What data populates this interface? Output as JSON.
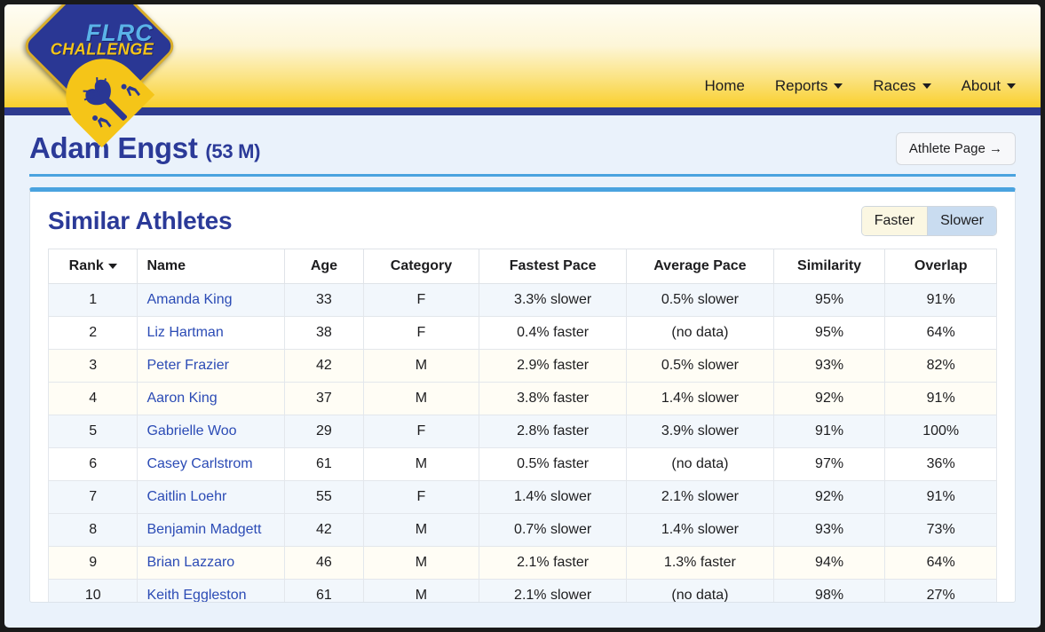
{
  "header": {
    "logo": {
      "line1": "FLRC",
      "line2": "CHALLENGE",
      "alt": "flrc-challenge-logo"
    },
    "nav": [
      {
        "label": "Home",
        "has_caret": false
      },
      {
        "label": "Reports",
        "has_caret": true
      },
      {
        "label": "Races",
        "has_caret": true
      },
      {
        "label": "About",
        "has_caret": true
      }
    ]
  },
  "page": {
    "athlete_name": "Adam Engst",
    "athlete_meta": "(53 M)",
    "athlete_page_button": "Athlete Page →"
  },
  "card": {
    "title": "Similar Athletes",
    "toggle": {
      "faster": "Faster",
      "slower": "Slower",
      "selected": "Slower"
    },
    "columns": [
      "Rank",
      "Name",
      "Age",
      "Category",
      "Fastest Pace",
      "Average Pace",
      "Similarity",
      "Overlap"
    ],
    "sorted_by": "Rank",
    "rows": [
      {
        "rank": "1",
        "name": "Amanda King",
        "age": "33",
        "category": "F",
        "fastest": "3.3% slower",
        "average": "0.5% slower",
        "similarity": "95%",
        "overlap": "91%",
        "tint": "blue"
      },
      {
        "rank": "2",
        "name": "Liz Hartman",
        "age": "38",
        "category": "F",
        "fastest": "0.4% faster",
        "average": "(no data)",
        "similarity": "95%",
        "overlap": "64%",
        "tint": "white"
      },
      {
        "rank": "3",
        "name": "Peter Frazier",
        "age": "42",
        "category": "M",
        "fastest": "2.9% faster",
        "average": "0.5% slower",
        "similarity": "93%",
        "overlap": "82%",
        "tint": "cream"
      },
      {
        "rank": "4",
        "name": "Aaron King",
        "age": "37",
        "category": "M",
        "fastest": "3.8% faster",
        "average": "1.4% slower",
        "similarity": "92%",
        "overlap": "91%",
        "tint": "cream"
      },
      {
        "rank": "5",
        "name": "Gabrielle Woo",
        "age": "29",
        "category": "F",
        "fastest": "2.8% faster",
        "average": "3.9% slower",
        "similarity": "91%",
        "overlap": "100%",
        "tint": "blue"
      },
      {
        "rank": "6",
        "name": "Casey Carlstrom",
        "age": "61",
        "category": "M",
        "fastest": "0.5% faster",
        "average": "(no data)",
        "similarity": "97%",
        "overlap": "36%",
        "tint": "white"
      },
      {
        "rank": "7",
        "name": "Caitlin Loehr",
        "age": "55",
        "category": "F",
        "fastest": "1.4% slower",
        "average": "2.1% slower",
        "similarity": "92%",
        "overlap": "91%",
        "tint": "blue"
      },
      {
        "rank": "8",
        "name": "Benjamin Madgett",
        "age": "42",
        "category": "M",
        "fastest": "0.7% slower",
        "average": "1.4% slower",
        "similarity": "93%",
        "overlap": "73%",
        "tint": "blue"
      },
      {
        "rank": "9",
        "name": "Brian Lazzaro",
        "age": "46",
        "category": "M",
        "fastest": "2.1% faster",
        "average": "1.3% faster",
        "similarity": "94%",
        "overlap": "64%",
        "tint": "cream"
      },
      {
        "rank": "10",
        "name": "Keith Eggleston",
        "age": "61",
        "category": "M",
        "fastest": "2.1% slower",
        "average": "(no data)",
        "similarity": "98%",
        "overlap": "27%",
        "tint": "blue"
      }
    ]
  },
  "colors": {
    "brand_navy": "#2b3a98",
    "brand_gold": "#f9cf2c",
    "accent_blue": "#4aa3df",
    "link_blue": "#2b4bb5",
    "page_bg": "#eaf2fb"
  }
}
